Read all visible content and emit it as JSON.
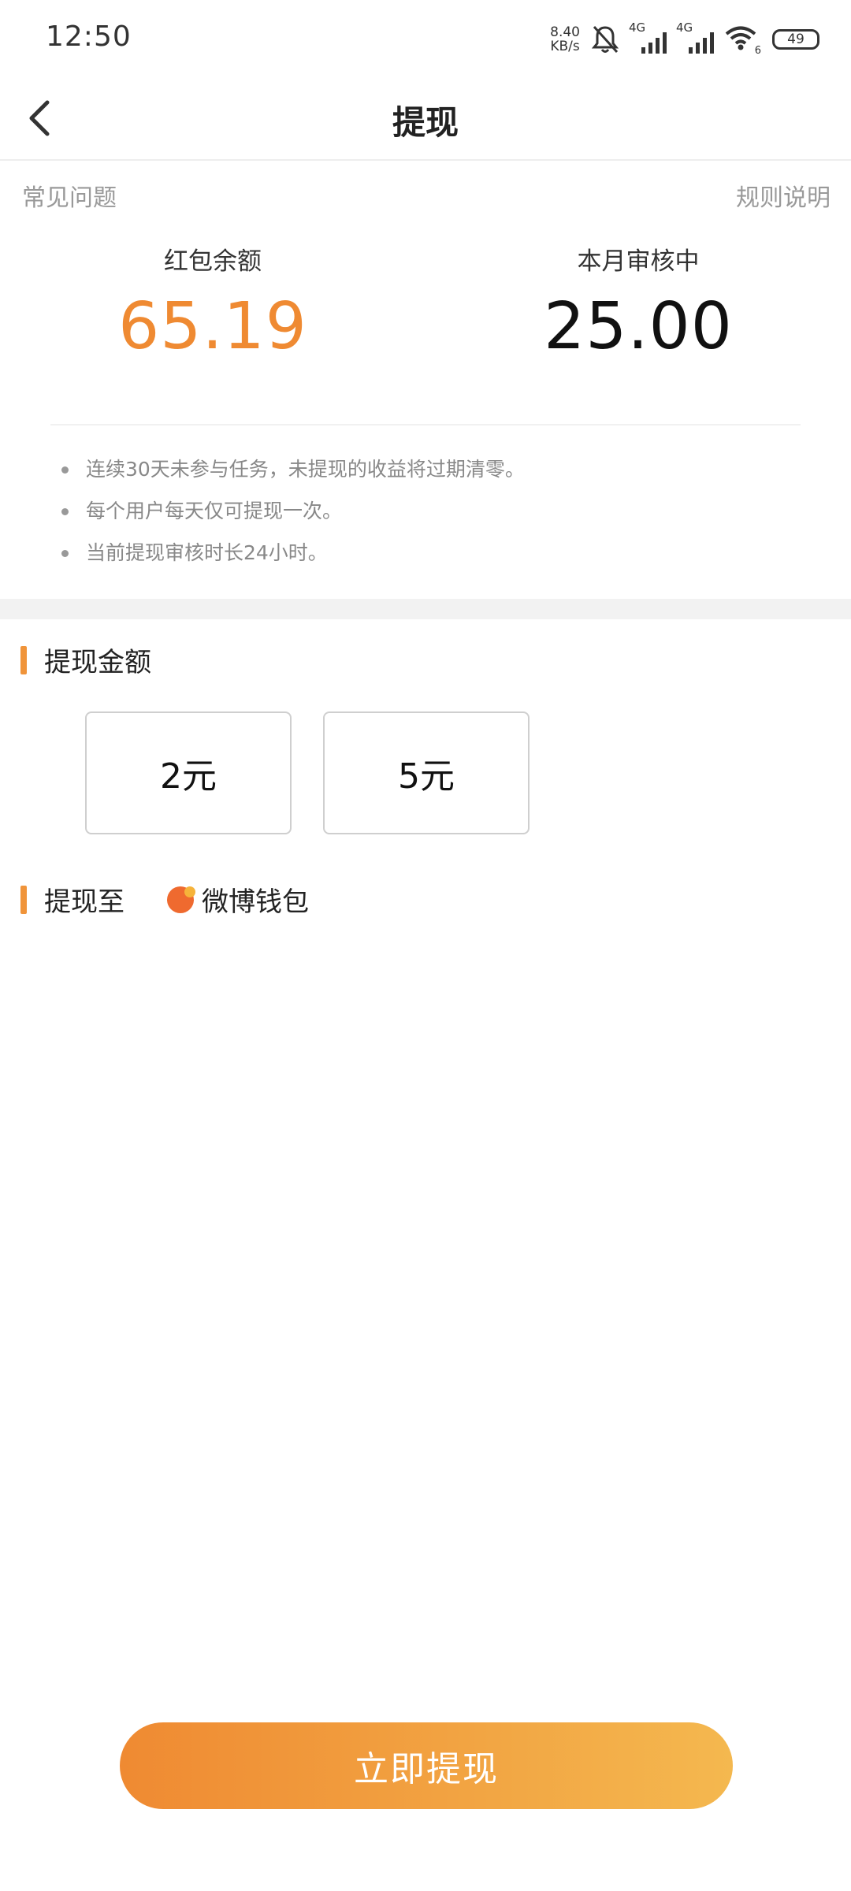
{
  "status_bar": {
    "time": "12:50",
    "net_speed_value": "8.40",
    "net_speed_unit": "KB/s",
    "sim1_label": "4G",
    "sim2_label": "4G",
    "wifi_sub": "6",
    "battery": "49"
  },
  "nav": {
    "title": "提现"
  },
  "links": {
    "faq": "常见问题",
    "rules": "规则说明"
  },
  "balances": {
    "red_packet_label": "红包余额",
    "red_packet_value": "65.19",
    "review_label": "本月审核中",
    "review_value": "25.00"
  },
  "rules": [
    "连续30天未参与任务，未提现的收益将过期清零。",
    "每个用户每天仅可提现一次。",
    "当前提现审核时长24小时。"
  ],
  "amount_section": {
    "title": "提现金额",
    "options": [
      "2元",
      "5元"
    ]
  },
  "destination": {
    "title": "提现至",
    "wallet": "微博钱包"
  },
  "submit_label": "立即提现",
  "colors": {
    "accent": "#f0943a",
    "balance": "#ef8a32",
    "button_gradient_start": "#ef8a32",
    "button_gradient_end": "#f4b84f"
  }
}
